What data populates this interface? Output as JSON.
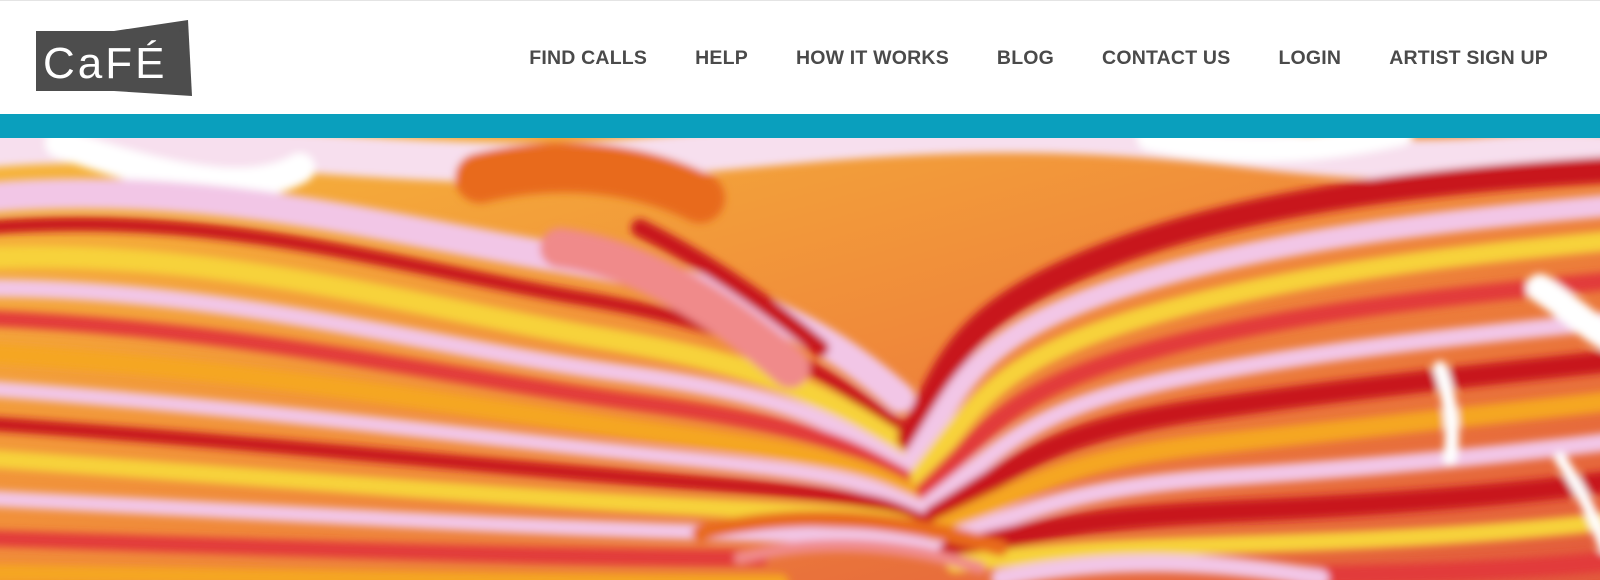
{
  "brand": {
    "logo_text": "CaFÉ",
    "trademark": "™",
    "logo_color": "#4d4d4d"
  },
  "nav": {
    "items": [
      {
        "label": "FIND CALLS"
      },
      {
        "label": "HELP"
      },
      {
        "label": "HOW IT WORKS"
      },
      {
        "label": "BLOG"
      },
      {
        "label": "CONTACT US"
      },
      {
        "label": "LOGIN"
      },
      {
        "label": "ARTIST SIGN UP"
      }
    ],
    "text_color": "#4a4a4a"
  },
  "accent_bar": {
    "color": "#0a9fbd"
  },
  "hero": {
    "image": "marbled-paint-swirl",
    "palette": [
      "#f4a41e",
      "#c8161f",
      "#e86a1a",
      "#f2c6e6",
      "#ffffff",
      "#f7d23a"
    ]
  }
}
